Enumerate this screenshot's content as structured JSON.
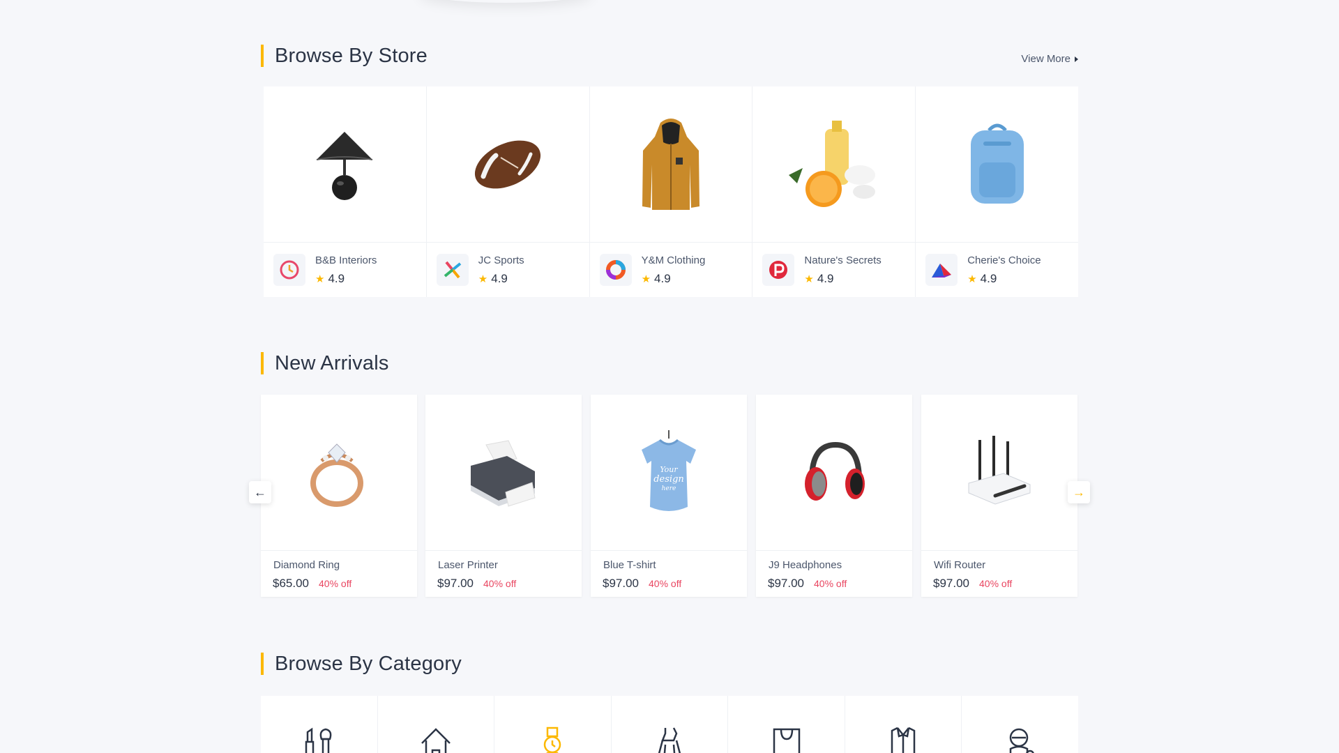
{
  "browse_by_store": {
    "title": "Browse By Store",
    "view_more": "View More",
    "stores": [
      {
        "name": "B&B Interiors",
        "rating": "4.9",
        "product_icon": "lamp-icon",
        "logo_icon": "clock-logo-icon"
      },
      {
        "name": "JC Sports",
        "rating": "4.9",
        "product_icon": "football-icon",
        "logo_icon": "pinwheel-logo-icon"
      },
      {
        "name": "Y&M Clothing",
        "rating": "4.9",
        "product_icon": "hoodie-icon",
        "logo_icon": "ring-logo-icon"
      },
      {
        "name": "Nature's Secrets",
        "rating": "4.9",
        "product_icon": "cosmetics-icon",
        "logo_icon": "p-logo-icon"
      },
      {
        "name": "Cherie's Choice",
        "rating": "4.9",
        "product_icon": "backpack-icon",
        "logo_icon": "triangle-logo-icon"
      }
    ]
  },
  "new_arrivals": {
    "title": "New Arrivals",
    "products": [
      {
        "name": "Diamond Ring",
        "price": "$65.00",
        "discount": "40% off",
        "icon": "ring-icon"
      },
      {
        "name": "Laser Printer",
        "price": "$97.00",
        "discount": "40% off",
        "icon": "printer-icon"
      },
      {
        "name": "Blue T-shirt",
        "price": "$97.00",
        "discount": "40% off",
        "icon": "tshirt-icon"
      },
      {
        "name": "J9 Headphones",
        "price": "$97.00",
        "discount": "40% off",
        "icon": "headphones-icon"
      },
      {
        "name": "Wifi Router",
        "price": "$97.00",
        "discount": "40% off",
        "icon": "router-icon"
      }
    ],
    "prev_icon": "arrow-left-icon",
    "next_icon": "arrow-right-icon"
  },
  "browse_by_category": {
    "title": "Browse By Category",
    "categories": [
      {
        "icon": "makeup-icon"
      },
      {
        "icon": "home-icon"
      },
      {
        "icon": "watch-icon"
      },
      {
        "icon": "dress-icon"
      },
      {
        "icon": "bag-icon"
      },
      {
        "icon": "shirt-icon"
      },
      {
        "icon": "baby-icon"
      }
    ]
  },
  "colors": {
    "accent": "#fcb800",
    "discount": "#e94560",
    "text": "#2b3445",
    "background": "#f6f7fa"
  }
}
